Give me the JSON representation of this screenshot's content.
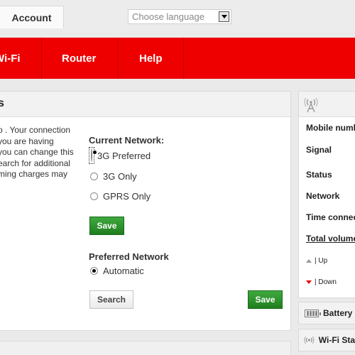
{
  "header": {
    "account_tab": "Account",
    "language_placeholder": "Choose language"
  },
  "nav": {
    "items": [
      "Wi-Fi",
      "Router",
      "Help"
    ]
  },
  "main": {
    "title": "s",
    "description": [
      "o . Your connection",
      "you are having",
      "you can change this",
      "earch for additional",
      "ming charges may"
    ],
    "current_network": {
      "heading": "Current Network:",
      "options": [
        "3G Preferred",
        "3G Only",
        "GPRS Only"
      ],
      "selected": "3G Preferred",
      "save_label": "Save"
    },
    "preferred_network": {
      "heading": "Preferred Network",
      "options": [
        "Automatic"
      ],
      "selected": "Automatic"
    },
    "search_label": "Search",
    "save_label": "Save"
  },
  "sidebar": {
    "mobile_number": "Mobile numb",
    "signal": "Signal",
    "status": "Status",
    "network": "Network",
    "time_connected": "Time connec",
    "total_volume": "Total volume",
    "up": "| Up",
    "down": "| Down",
    "battery": "Battery",
    "wifi_status": "Wi-Fi Sta"
  },
  "colors": {
    "nav_red": "#ee0000",
    "save_green": "#2a8c2a",
    "down_red": "#ee0000"
  }
}
